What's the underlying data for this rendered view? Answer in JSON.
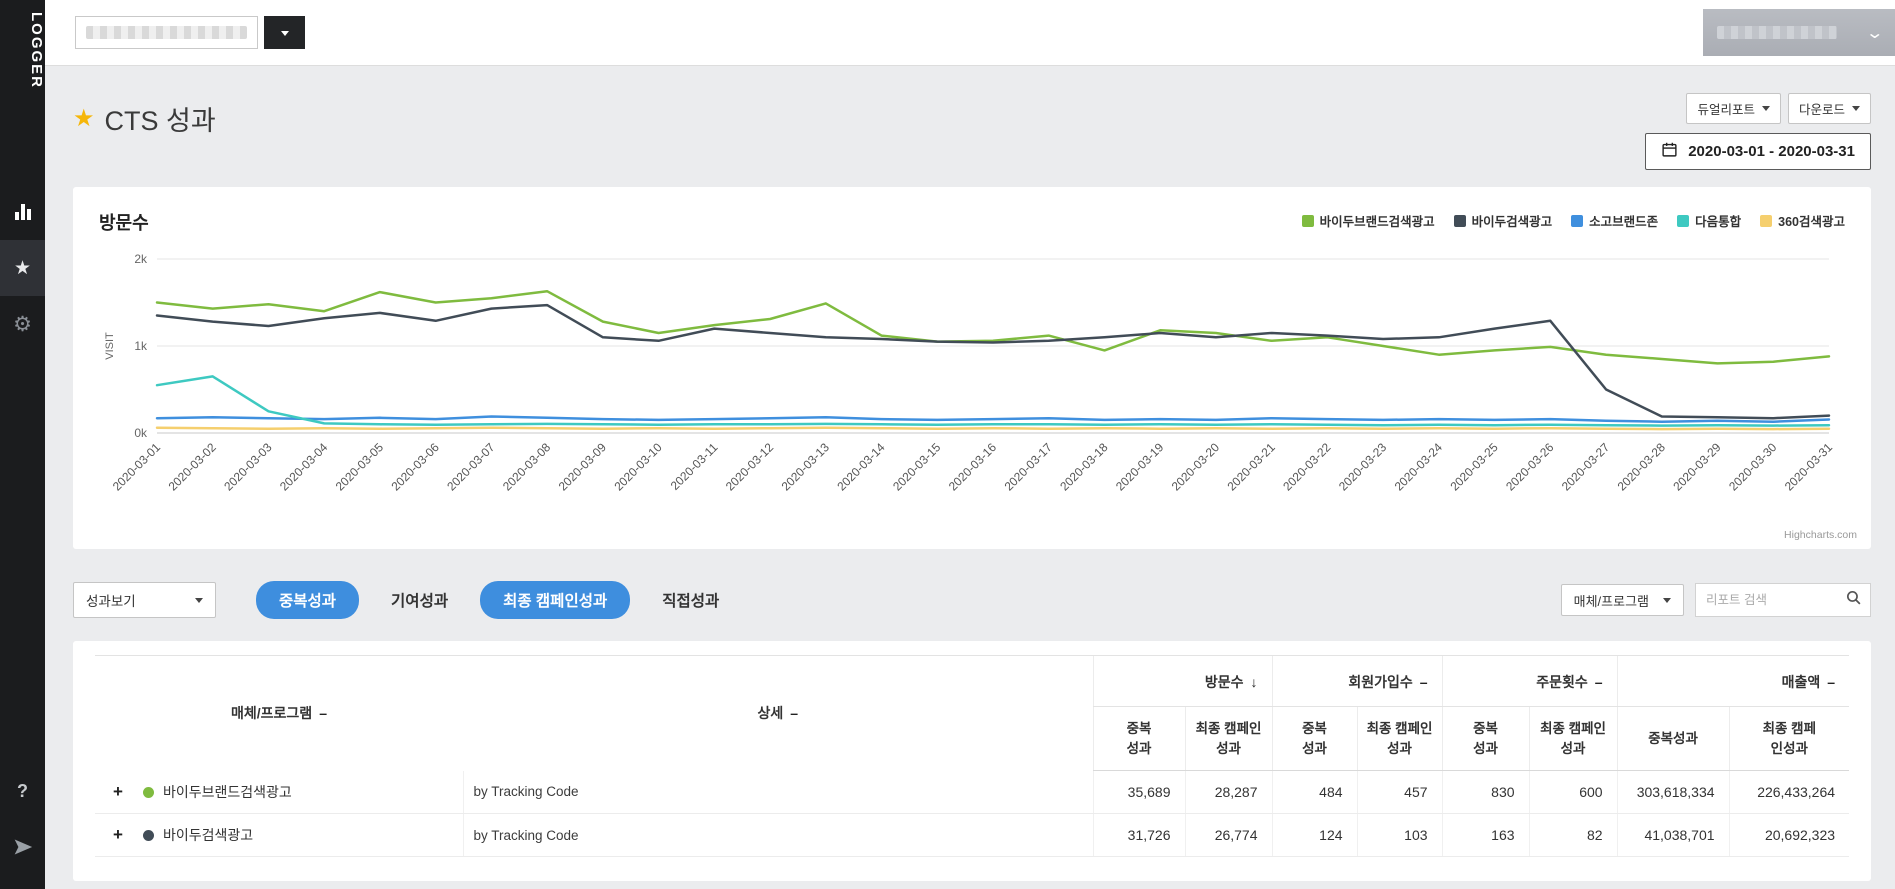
{
  "sidebar": {
    "logo": "LOGGER",
    "items": [
      {
        "name": "reports",
        "icon": "bar-chart-icon"
      },
      {
        "name": "favorites",
        "icon": "star-icon",
        "active": true
      },
      {
        "name": "settings",
        "icon": "gear-icon"
      },
      {
        "name": "help",
        "icon": "question-icon"
      },
      {
        "name": "send",
        "icon": "paper-plane-icon"
      }
    ]
  },
  "page": {
    "title": "CTS 성과"
  },
  "header_actions": {
    "dual_report": "듀얼리포트",
    "download": "다운로드",
    "date_range": "2020-03-01 - 2020-03-31"
  },
  "chart": {
    "title": "방문수",
    "ylabel": "VISIT",
    "credit": "Highcharts.com"
  },
  "chart_data": {
    "type": "line",
    "title": "방문수",
    "xlabel": "",
    "ylabel": "VISIT",
    "ylim": [
      0,
      2000
    ],
    "grid": true,
    "legend_position": "top-right",
    "yticks": [
      "0k",
      "1k",
      "2k"
    ],
    "dates": [
      "2020-03-01",
      "2020-03-02",
      "2020-03-03",
      "2020-03-04",
      "2020-03-05",
      "2020-03-06",
      "2020-03-07",
      "2020-03-08",
      "2020-03-09",
      "2020-03-10",
      "2020-03-11",
      "2020-03-12",
      "2020-03-13",
      "2020-03-14",
      "2020-03-15",
      "2020-03-16",
      "2020-03-17",
      "2020-03-18",
      "2020-03-19",
      "2020-03-20",
      "2020-03-21",
      "2020-03-22",
      "2020-03-23",
      "2020-03-24",
      "2020-03-25",
      "2020-03-26",
      "2020-03-27",
      "2020-03-28",
      "2020-03-29",
      "2020-03-30",
      "2020-03-31"
    ],
    "series": [
      {
        "name": "바이두브랜드검색광고",
        "color": "#7fbb3f",
        "values": [
          1500,
          1430,
          1480,
          1400,
          1620,
          1500,
          1550,
          1630,
          1280,
          1150,
          1240,
          1310,
          1490,
          1120,
          1050,
          1060,
          1120,
          950,
          1180,
          1150,
          1060,
          1100,
          1000,
          900,
          950,
          990,
          900,
          850,
          800,
          820,
          880
        ]
      },
      {
        "name": "바이두검색광고",
        "color": "#414c57",
        "values": [
          1350,
          1280,
          1230,
          1320,
          1380,
          1290,
          1430,
          1470,
          1100,
          1060,
          1200,
          1150,
          1100,
          1080,
          1050,
          1040,
          1060,
          1100,
          1150,
          1100,
          1150,
          1120,
          1080,
          1100,
          1200,
          1290,
          500,
          190,
          180,
          170,
          200
        ]
      },
      {
        "name": "소고브랜드존",
        "color": "#3f8fde",
        "values": [
          170,
          180,
          170,
          160,
          175,
          160,
          190,
          175,
          160,
          150,
          160,
          170,
          180,
          160,
          150,
          160,
          170,
          150,
          160,
          150,
          170,
          160,
          150,
          160,
          150,
          160,
          140,
          130,
          140,
          130,
          155
        ]
      },
      {
        "name": "다음통합",
        "color": "#3ec9c1",
        "values": [
          550,
          650,
          250,
          110,
          100,
          95,
          100,
          105,
          100,
          95,
          100,
          100,
          105,
          100,
          95,
          100,
          100,
          95,
          100,
          95,
          100,
          95,
          90,
          95,
          90,
          95,
          90,
          85,
          90,
          85,
          90
        ]
      },
      {
        "name": "360검색광고",
        "color": "#f5cf6e",
        "values": [
          60,
          55,
          50,
          55,
          50,
          55,
          60,
          55,
          50,
          55,
          50,
          55,
          60,
          55,
          50,
          55,
          50,
          55,
          50,
          55,
          50,
          55,
          50,
          55,
          50,
          55,
          50,
          45,
          50,
          45,
          50
        ]
      }
    ]
  },
  "filters": {
    "view_select": "성과보기",
    "tabs": [
      {
        "label": "중복성과"
      },
      {
        "label": "기여성과"
      },
      {
        "label": "최종 캠페인성과"
      },
      {
        "label": "직접성과"
      }
    ],
    "media_select": "매체/프로그램",
    "search_placeholder": "리포트 검색"
  },
  "table": {
    "columns": {
      "media": {
        "label": "매체/프로그램",
        "sort": "–"
      },
      "detail": {
        "label": "상세",
        "sort": "–"
      },
      "groups": [
        {
          "label": "방문수",
          "sort": "↓",
          "sub": [
            "중복\n성과",
            "최종 캠페인\n성과"
          ]
        },
        {
          "label": "회원가입수",
          "sort": "–",
          "sub": [
            "중복\n성과",
            "최종 캠페인\n성과"
          ]
        },
        {
          "label": "주문횟수",
          "sort": "–",
          "sub": [
            "중복\n성과",
            "최종 캠페인\n성과"
          ]
        },
        {
          "label": "매출액",
          "sort": "–",
          "sub": [
            "중복성과",
            "최종 캠페\n인성과"
          ]
        }
      ]
    },
    "rows": [
      {
        "name": "바이두브랜드검색광고",
        "color": "#7fbb3f",
        "detail": "by Tracking Code",
        "values": [
          "35,689",
          "28,287",
          "484",
          "457",
          "830",
          "600",
          "303,618,334",
          "226,433,264"
        ]
      },
      {
        "name": "바이두검색광고",
        "color": "#414c57",
        "detail": "by Tracking Code",
        "values": [
          "31,726",
          "26,774",
          "124",
          "103",
          "163",
          "82",
          "41,038,701",
          "20,692,323"
        ]
      }
    ]
  }
}
